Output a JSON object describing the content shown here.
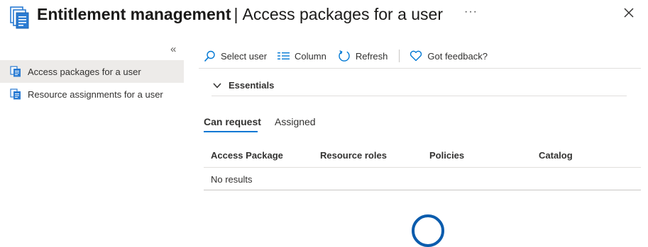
{
  "header": {
    "title": "Entitlement management",
    "separator": "|",
    "subtitle": "Access packages for a user",
    "more_label": "···",
    "icon": "document-stack-icon"
  },
  "nav": {
    "collapse_label": "«",
    "items": [
      {
        "label": "Access packages for a user",
        "active": true,
        "icon": "document-icon"
      },
      {
        "label": "Resource assignments for a user",
        "active": false,
        "icon": "document-icon"
      }
    ]
  },
  "toolbar": {
    "select_user": "Select user",
    "column": "Column",
    "refresh": "Refresh",
    "feedback": "Got feedback?"
  },
  "essentials": {
    "label": "Essentials"
  },
  "tabs": [
    {
      "label": "Can request",
      "active": true
    },
    {
      "label": "Assigned",
      "active": false
    }
  ],
  "table": {
    "headers": [
      "Access Package",
      "Resource roles",
      "Policies",
      "Catalog"
    ],
    "empty_text": "No results"
  },
  "colors": {
    "accent": "#0078d4",
    "nav_active_bg": "#edebe9",
    "icon_blue": "#2b7cd3",
    "spinner": "#0b5cad"
  }
}
